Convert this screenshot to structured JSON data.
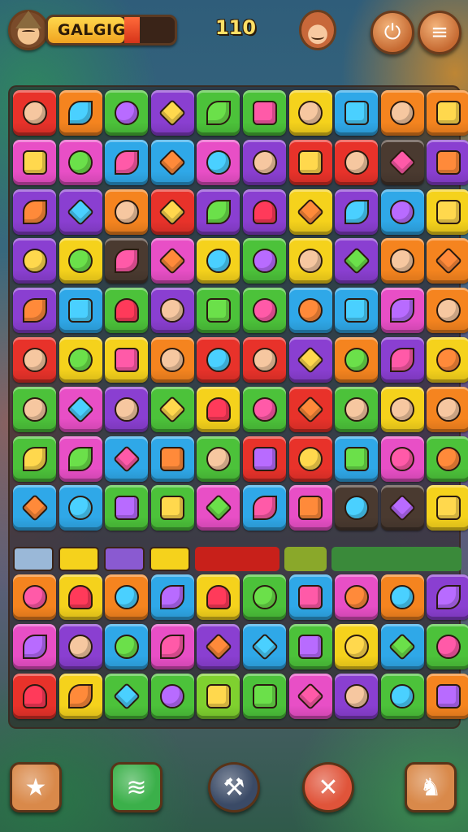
{
  "header": {
    "player_name": "GALGIG",
    "score": "110",
    "progress": 0.72,
    "danger_segment": 0.12
  },
  "colors": {
    "red": "#e8322a",
    "orange": "#f5841f",
    "green": "#4cc23a",
    "blue": "#2fa8e8",
    "purple": "#8a3fd1",
    "yellow": "#f5d21c",
    "pink": "#e84fc6",
    "lime": "#7fd12f",
    "brown": "#a8642c",
    "dark": "#4a3a30"
  },
  "board": {
    "rows": [
      [
        "red:face",
        "orange:leaf",
        "green:circle",
        "purple:gem",
        "green:leaf",
        "green:sq",
        "yellow:face",
        "blue:sq",
        "orange:face",
        "orange:sq"
      ],
      [
        "pink:sq",
        "pink:circle",
        "blue:leaf",
        "blue:gem",
        "pink:circle",
        "purple:face",
        "red:sq",
        "red:face",
        "dark:gem",
        "purple:sq"
      ],
      [
        "purple:leaf",
        "purple:gem",
        "orange:face",
        "red:gem",
        "purple:leaf",
        "purple:heart",
        "yellow:gem",
        "purple:leaf",
        "blue:circle",
        "yellow:sq"
      ],
      [
        "purple:circle",
        "yellow:circle",
        "dark:leaf",
        "pink:gem",
        "yellow:circle",
        "green:circle",
        "yellow:face",
        "purple:gem",
        "orange:face",
        "orange:gem"
      ],
      [
        "purple:leaf",
        "blue:sq",
        "green:heart",
        "purple:face",
        "green:sq",
        "green:circle",
        "blue:circle",
        "blue:sq",
        "pink:leaf",
        "orange:face"
      ],
      [
        "red:face",
        "yellow:circle",
        "yellow:sq",
        "orange:face",
        "red:circle",
        "red:face",
        "purple:gem",
        "orange:circle",
        "purple:leaf",
        "yellow:circle"
      ],
      [
        "green:face",
        "pink:gem",
        "purple:face",
        "green:gem",
        "yellow:heart",
        "green:circle",
        "red:gem",
        "green:face",
        "yellow:face",
        "orange:face"
      ],
      [
        "green:leaf",
        "pink:leaf",
        "blue:gem",
        "blue:sq",
        "green:face",
        "red:sq",
        "red:circle",
        "blue:sq",
        "pink:circle",
        "green:circle"
      ],
      [
        "blue:gem",
        "blue:circle",
        "green:sq",
        "green:sq",
        "pink:gem",
        "blue:leaf",
        "pink:sq",
        "dark:circle",
        "dark:gem",
        "yellow:sq"
      ]
    ],
    "rows_lower": [
      [
        "orange:circle",
        "yellow:heart",
        "orange:circle",
        "blue:leaf",
        "yellow:heart",
        "green:circle",
        "blue:sq",
        "pink:circle",
        "orange:circle",
        "purple:leaf"
      ],
      [
        "pink:leaf",
        "purple:face",
        "blue:circle",
        "pink:leaf",
        "purple:gem",
        "blue:gem",
        "green:sq",
        "yellow:circle",
        "blue:gem",
        "green:circle"
      ],
      [
        "red:heart",
        "yellow:leaf",
        "green:gem",
        "green:circle",
        "lime:sq",
        "green:sq",
        "pink:gem",
        "purple:face",
        "green:circle",
        "orange:sq"
      ]
    ],
    "strip": [
      {
        "color": "blue",
        "w": 50
      },
      {
        "color": "yellow",
        "w": 50
      },
      {
        "color": "purple",
        "w": 50
      },
      {
        "color": "yellow",
        "w": 50
      },
      {
        "color": "red",
        "w": 104
      },
      {
        "color": "lime",
        "w": 52
      },
      {
        "color": "green",
        "w": 160
      }
    ]
  },
  "footer": {
    "buttons": [
      {
        "name": "star-button",
        "icon": "star-icon",
        "glyph": "★",
        "bg": "#d9894a"
      },
      {
        "name": "boost-button",
        "icon": "swirl-icon",
        "glyph": "≋",
        "bg": "#3bb04a"
      },
      {
        "name": "tool-button",
        "icon": "wrench-icon",
        "glyph": "⚒",
        "bg": "#3a4a66"
      },
      {
        "name": "close-button",
        "icon": "close-icon",
        "glyph": "✕",
        "bg": "#e0543a"
      },
      {
        "name": "pet-button",
        "icon": "animal-icon",
        "glyph": "♞",
        "bg": "#d9894a"
      }
    ]
  }
}
